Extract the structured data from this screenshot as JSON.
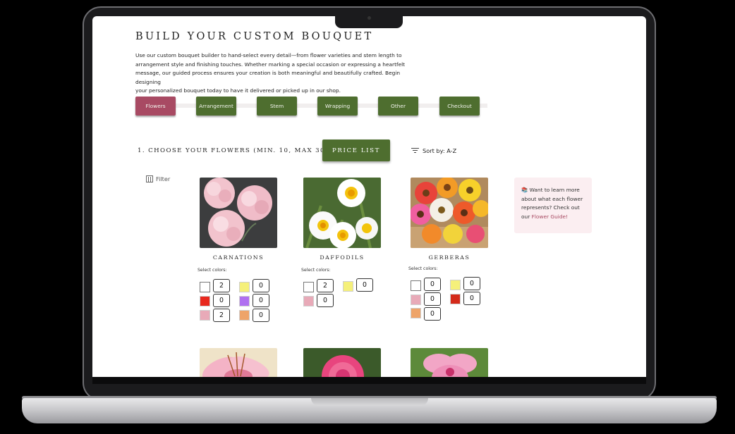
{
  "page": {
    "title": "BUILD YOUR CUSTOM BOUQUET",
    "intro_lines": [
      "Use our custom bouquet builder to hand-select every detail—from flower varieties and stem length to",
      "arrangement style and finishing touches. Whether marking a special occasion or expressing a heartfelt",
      "message, our guided process ensures your creation is both meaningful and beautifully crafted. Begin designing",
      "your personalized bouquet today to have it delivered or picked up in our shop."
    ]
  },
  "steps": [
    {
      "label": "Flowers",
      "active": true
    },
    {
      "label": "Arrangement",
      "active": false
    },
    {
      "label": "Stem",
      "active": false
    },
    {
      "label": "Wrapping",
      "active": false
    },
    {
      "label": "Other",
      "active": false
    },
    {
      "label": "Checkout",
      "active": false
    }
  ],
  "section": {
    "title": "1. CHOOSE YOUR FLOWERS (MIN. 10, MAX 30)",
    "price_button": "PRICE LIST",
    "sort_label": "Sort by: A-Z",
    "filter_label": "Filter"
  },
  "flowers": [
    {
      "name": "CARNATIONS",
      "select_label": "Select colors:",
      "colors": [
        {
          "swatch": "#ffffff",
          "qty": "2"
        },
        {
          "swatch": "#f5f07a",
          "qty": "0"
        },
        {
          "swatch": "#e8281e",
          "qty": "0"
        },
        {
          "swatch": "#b070f0",
          "qty": "0"
        },
        {
          "swatch": "#e8aab8",
          "qty": "2"
        },
        {
          "swatch": "#eea46a",
          "qty": "0"
        }
      ]
    },
    {
      "name": "DAFFODILS",
      "select_label": "Select colors:",
      "colors": [
        {
          "swatch": "#ffffff",
          "qty": "2"
        },
        {
          "swatch": "#f5f07a",
          "qty": "0"
        },
        {
          "swatch": "#e8aab8",
          "qty": "0"
        }
      ]
    },
    {
      "name": "GERBERAS",
      "select_label": "Select colors:",
      "colors": [
        {
          "swatch": "#ffffff",
          "qty": "0"
        },
        {
          "swatch": "#f5f07a",
          "qty": "0"
        },
        {
          "swatch": "#e8aab8",
          "qty": "0"
        },
        {
          "swatch": "#d42a1a",
          "qty": "0"
        },
        {
          "swatch": "#eea46a",
          "qty": "0"
        }
      ]
    }
  ],
  "guide": {
    "icon": "book-icon",
    "text": "Want to learn more about what each flower represents? Check out our ",
    "link": "Flower Guide!"
  }
}
